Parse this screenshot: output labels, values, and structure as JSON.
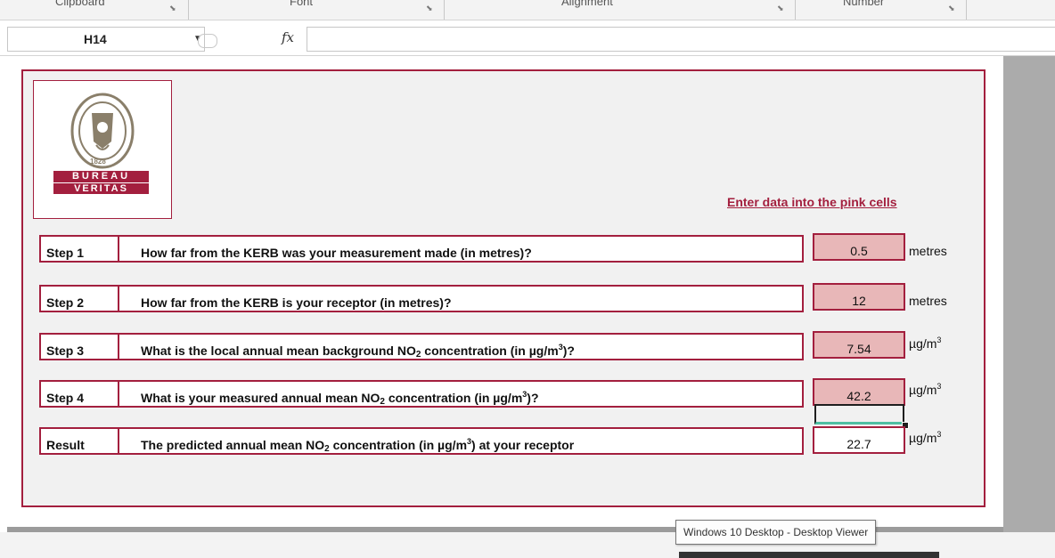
{
  "ribbon": {
    "groups": [
      "Clipboard",
      "Font",
      "Alignment",
      "Number"
    ]
  },
  "formula_bar": {
    "name_box": "H14",
    "fx_label": "fx",
    "formula": ""
  },
  "logo": {
    "year": "1828",
    "line1": "BUREAU",
    "line2": "VERITAS"
  },
  "instruction": "Enter data into the pink cells",
  "steps": [
    {
      "label": "Step 1",
      "question": "How far from the KERB was your measurement made (in metres)?",
      "value": "0.5",
      "unit": "metres"
    },
    {
      "label": "Step 2",
      "question": "How far from the KERB is your receptor (in metres)?",
      "value": "12",
      "unit": "metres"
    },
    {
      "label": "Step 3",
      "question_parts": [
        "What is the local annual mean background NO",
        "2",
        " concentration (in µg/m",
        "3",
        ")?"
      ],
      "value": "7.54",
      "unit_base": "µg/m",
      "unit_sup": "3"
    },
    {
      "label": "Step 4",
      "question_parts": [
        "What is your measured annual mean NO",
        "2",
        " concentration (in µg/m",
        "3",
        ")?"
      ],
      "value": "42.2",
      "unit_base": "µg/m",
      "unit_sup": "3"
    }
  ],
  "result": {
    "label": "Result",
    "question_parts": [
      "The predicted annual mean NO",
      "2",
      " concentration (in µg/m",
      "3",
      ") at your receptor"
    ],
    "value": "22.7",
    "unit_base": "µg/m",
    "unit_sup": "3"
  },
  "tooltip": "Windows 10 Desktop - Desktop Viewer",
  "colors": {
    "border": "#a31f3e",
    "input_fill": "#e8b7b8",
    "instruction": "#a31f3e"
  }
}
